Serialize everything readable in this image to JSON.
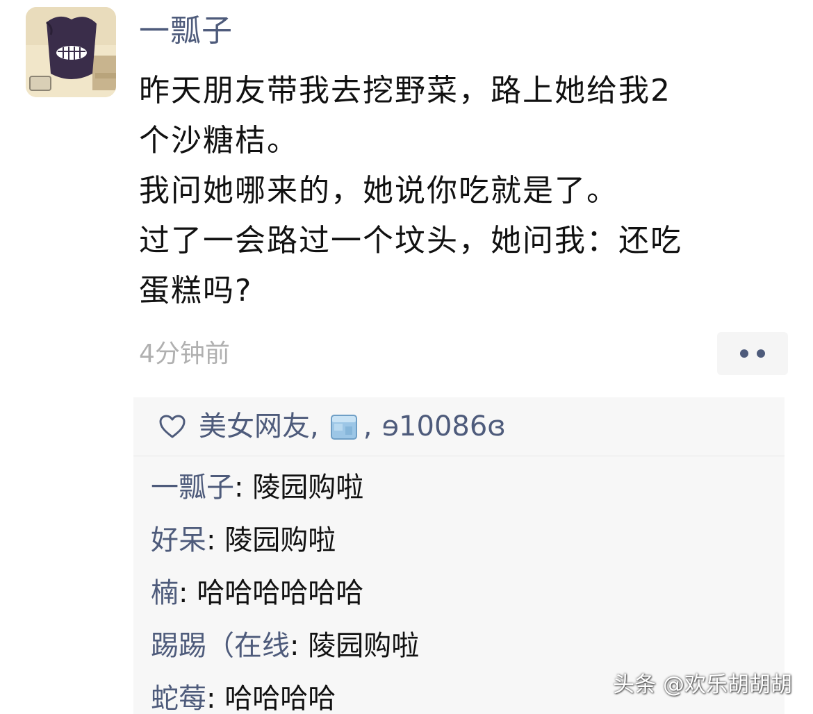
{
  "post": {
    "author": "一瓢子",
    "text_lines": [
      "昨天朋友带我去挖野菜，路上她给我2",
      "个沙糖桔。",
      "我问她哪来的，她说你吃就是了。",
      "过了一会路过一个坟头，她问我：还吃",
      "蛋糕吗?"
    ],
    "time": "4分钟前",
    "more_icon": "ellipsis-icon"
  },
  "likes": {
    "icon": "heart-icon",
    "name1": "美女网友",
    "sep1": ",",
    "ice_icon": "ice-cube-icon",
    "sep2": ",",
    "name3": "ɘ10086ɞ"
  },
  "comments": [
    {
      "name": "一瓢子",
      "colon": ": ",
      "text": "陵园购啦"
    },
    {
      "name": "好呆",
      "colon": ": ",
      "text": "陵园购啦"
    },
    {
      "name": "楠",
      "colon": ": ",
      "text": "哈哈哈哈哈哈"
    },
    {
      "name": "踢踢（在线",
      "colon": ": ",
      "text": "陵园购啦"
    },
    {
      "name": "蛇莓",
      "colon": ": ",
      "text": "哈哈哈哈"
    }
  ],
  "watermark": "头条 @欢乐胡胡胡",
  "colors": {
    "name_blue": "#4e5b7b",
    "text": "#111111",
    "time_gray": "#b0b0b0",
    "panel_bg": "#f7f7f7"
  }
}
